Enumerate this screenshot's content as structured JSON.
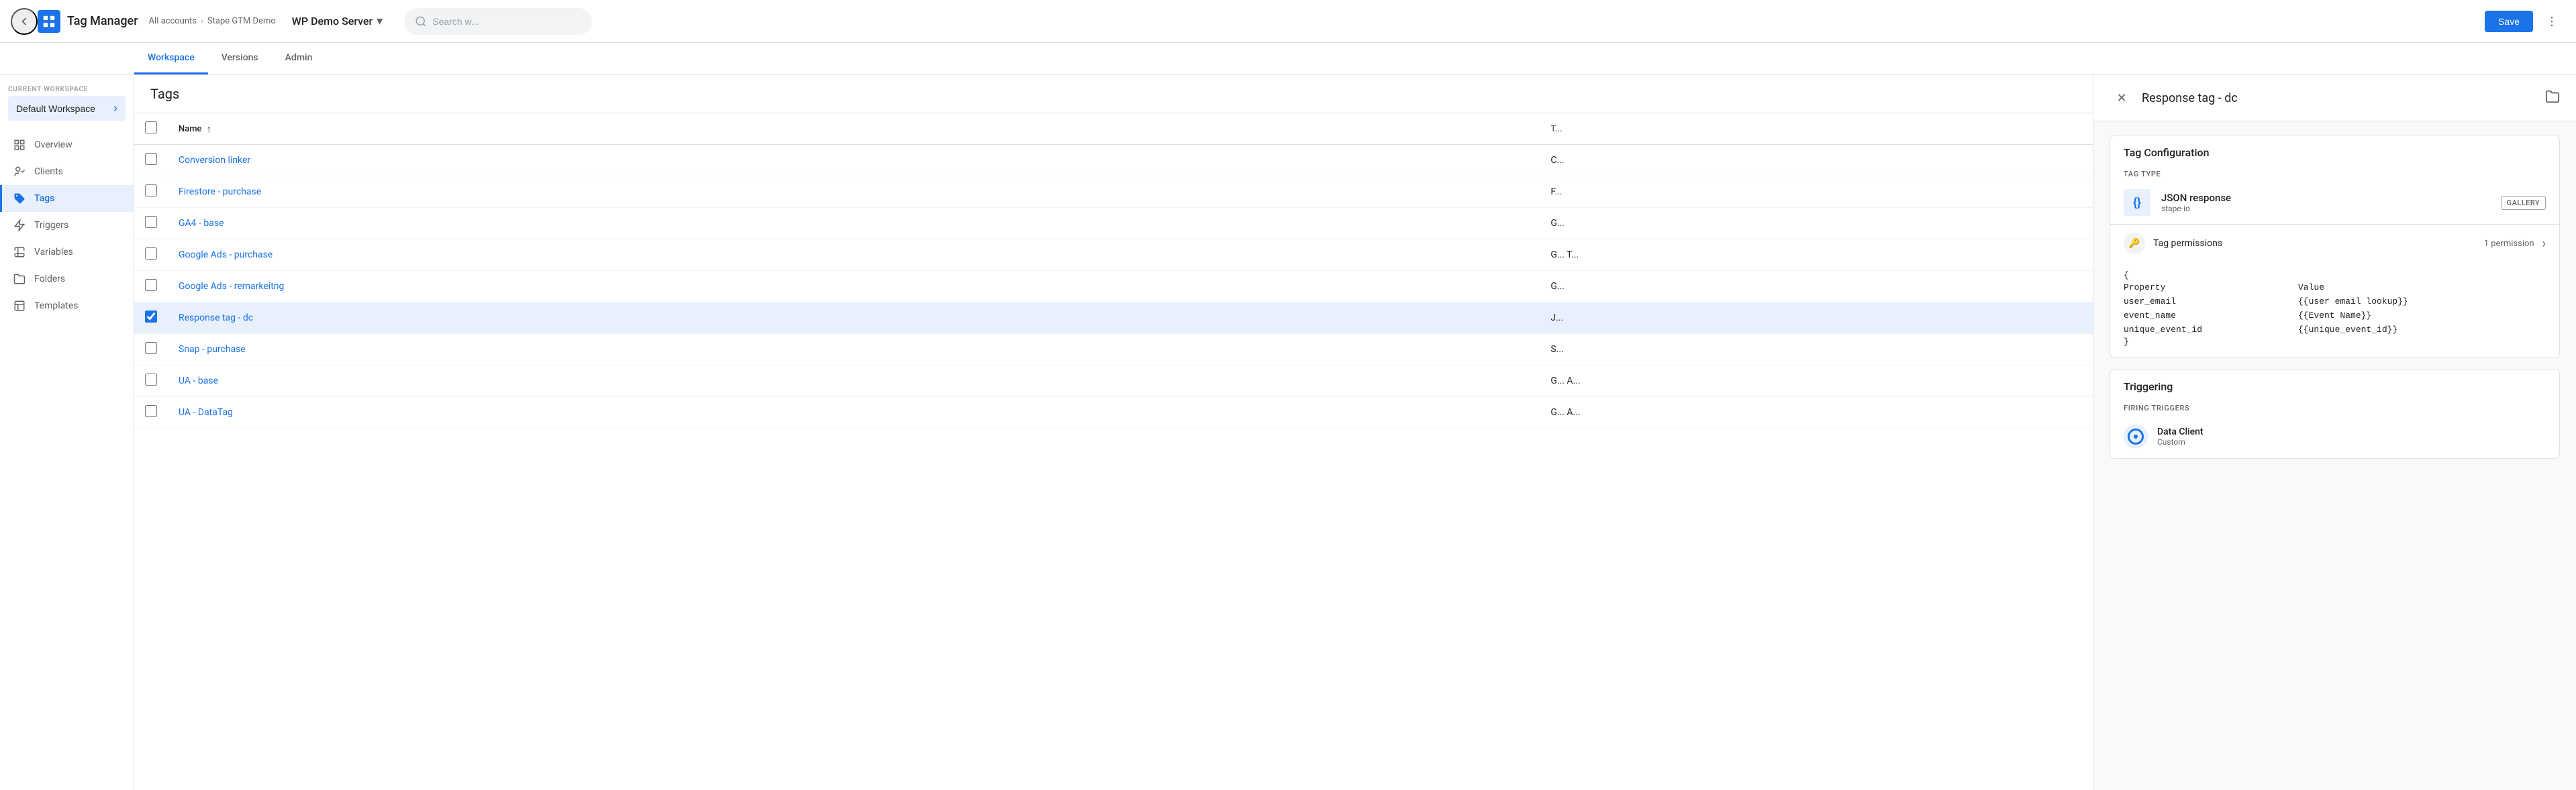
{
  "app": {
    "name": "Tag Manager",
    "logo_alt": "GTM logo"
  },
  "header": {
    "back_label": "←",
    "breadcrumb": {
      "part1": "All accounts",
      "separator": "›",
      "part2": "Stape GTM Demo"
    },
    "workspace_name": "WP Demo Server",
    "search_placeholder": "Search w...",
    "save_label": "Save",
    "more_label": "⋮"
  },
  "sub_nav": {
    "items": [
      {
        "label": "Workspace",
        "active": true
      },
      {
        "label": "Versions",
        "active": false
      },
      {
        "label": "Admin",
        "active": false
      }
    ]
  },
  "sidebar": {
    "workspace_section_label": "Current Workspace",
    "workspace_name": "Default Workspace",
    "nav_items": [
      {
        "label": "Overview",
        "icon": "overview-icon",
        "active": false
      },
      {
        "label": "Clients",
        "icon": "clients-icon",
        "active": false
      },
      {
        "label": "Tags",
        "icon": "tags-icon",
        "active": true
      },
      {
        "label": "Triggers",
        "icon": "triggers-icon",
        "active": false
      },
      {
        "label": "Variables",
        "icon": "variables-icon",
        "active": false
      },
      {
        "label": "Folders",
        "icon": "folders-icon",
        "active": false
      },
      {
        "label": "Templates",
        "icon": "templates-icon",
        "active": false
      }
    ]
  },
  "tags_table": {
    "title": "Tags",
    "column_name": "Name",
    "column_type": "T...",
    "rows": [
      {
        "name": "Conversion linker",
        "type": "C...",
        "selected": false
      },
      {
        "name": "Firestore - purchase",
        "type": "F...",
        "selected": false
      },
      {
        "name": "GA4 - base",
        "type": "G...",
        "selected": false
      },
      {
        "name": "Google Ads - purchase",
        "type": "G... T...",
        "selected": false
      },
      {
        "name": "Google Ads - remarkeitng",
        "type": "G...",
        "selected": false
      },
      {
        "name": "Response tag - dc",
        "type": "J...",
        "selected": true
      },
      {
        "name": "Snap - purchase",
        "type": "S...",
        "selected": false
      },
      {
        "name": "UA - base",
        "type": "G... A...",
        "selected": false
      },
      {
        "name": "UA - DataTag",
        "type": "G... A...",
        "selected": false
      }
    ]
  },
  "detail": {
    "close_label": "✕",
    "title": "Response tag - dc",
    "folder_icon": "folder",
    "tag_config": {
      "section_title": "Tag Configuration",
      "tag_type_label": "Tag Type",
      "tag_name": "JSON response",
      "tag_provider": "stape-io",
      "gallery_badge": "GALLERY",
      "permissions_label": "Tag permissions",
      "permissions_count": "1 permission",
      "json_open": "{",
      "json_properties_label": "Property",
      "json_values_label": "Value",
      "json_rows": [
        {
          "property": "user_email",
          "value": "{{user email lookup}}"
        },
        {
          "property": "event_name",
          "value": "{{Event Name}}"
        },
        {
          "property": "unique_event_id",
          "value": "{{unique_event_id}}"
        }
      ],
      "json_close": "}"
    },
    "triggering": {
      "section_title": "Triggering",
      "firing_triggers_label": "Firing Triggers",
      "trigger_name": "Data Client",
      "trigger_type": "Custom"
    }
  },
  "colors": {
    "primary": "#1a73e8",
    "active_bg": "#e8f0fe",
    "border": "#e0e0e0",
    "text_primary": "#202124",
    "text_secondary": "#5f6368"
  }
}
